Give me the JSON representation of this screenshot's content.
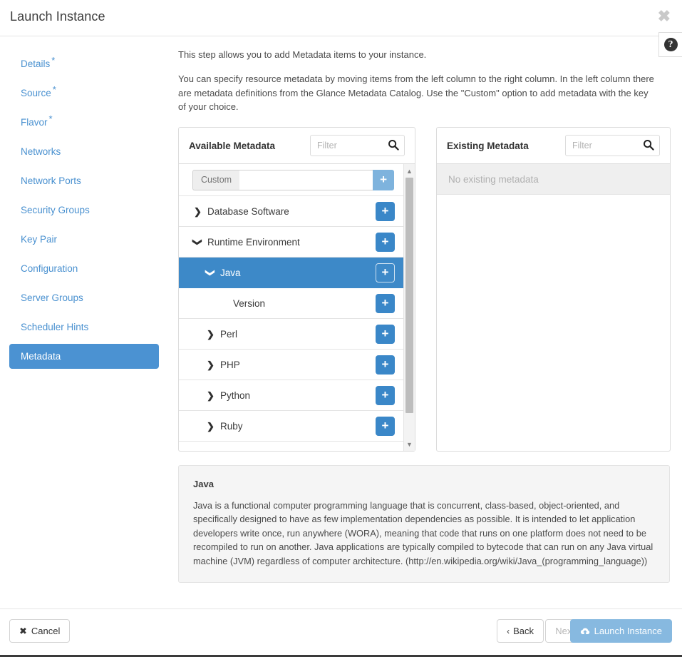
{
  "window": {
    "title": "Launch Instance",
    "close_label": "✖",
    "help_label": "?"
  },
  "sidebar": {
    "items": [
      {
        "label": "Details",
        "required": true,
        "active": false
      },
      {
        "label": "Source",
        "required": true,
        "active": false
      },
      {
        "label": "Flavor",
        "required": true,
        "active": false
      },
      {
        "label": "Networks",
        "required": false,
        "active": false
      },
      {
        "label": "Network Ports",
        "required": false,
        "active": false
      },
      {
        "label": "Security Groups",
        "required": false,
        "active": false
      },
      {
        "label": "Key Pair",
        "required": false,
        "active": false
      },
      {
        "label": "Configuration",
        "required": false,
        "active": false
      },
      {
        "label": "Server Groups",
        "required": false,
        "active": false
      },
      {
        "label": "Scheduler Hints",
        "required": false,
        "active": false
      },
      {
        "label": "Metadata",
        "required": false,
        "active": true
      }
    ],
    "required_marker": "*"
  },
  "main": {
    "intro_line_1": "This step allows you to add Metadata items to your instance.",
    "intro_line_2": "You can specify resource metadata by moving items from the left column to the right column. In the left column there are metadata definitions from the Glance Metadata Catalog. Use the \"Custom\" option to add metadata with the key of your choice."
  },
  "available_panel": {
    "title": "Available Metadata",
    "filter_placeholder": "Filter",
    "filter_value": "",
    "custom_row": {
      "tag_label": "Custom",
      "input_value": "",
      "input_placeholder": "",
      "add_label": "+"
    },
    "add_label": "+",
    "tree": [
      {
        "label": "Database Software",
        "level": 0,
        "chevron": "collapsed",
        "selected": false
      },
      {
        "label": "Runtime Environment",
        "level": 0,
        "chevron": "expanded",
        "selected": false
      },
      {
        "label": "Java",
        "level": 1,
        "chevron": "expanded",
        "selected": true
      },
      {
        "label": "Version",
        "level": 2,
        "chevron": "none",
        "selected": false
      },
      {
        "label": "Perl",
        "level": 1,
        "chevron": "collapsed",
        "selected": false
      },
      {
        "label": "PHP",
        "level": 1,
        "chevron": "collapsed",
        "selected": false
      },
      {
        "label": "Python",
        "level": 1,
        "chevron": "collapsed",
        "selected": false
      },
      {
        "label": "Ruby",
        "level": 1,
        "chevron": "collapsed",
        "selected": false
      }
    ]
  },
  "existing_panel": {
    "title": "Existing Metadata",
    "filter_placeholder": "Filter",
    "filter_value": "",
    "empty_message": "No existing metadata"
  },
  "description": {
    "title": "Java",
    "body": "Java is a functional computer programming language that is concurrent, class-based, object-oriented, and specifically designed to have as few implementation dependencies as possible. It is intended to let application developers write once, run anywhere (WORA), meaning that code that runs on one platform does not need to be recompiled to run on another. Java applications are typically compiled to bytecode that can run on any Java virtual machine (JVM) regardless of computer architecture. (http://en.wikipedia.org/wiki/Java_(programming_language))"
  },
  "footer": {
    "cancel_label": "Cancel",
    "back_label": "Back",
    "next_label": "Next",
    "launch_label": "Launch Instance",
    "next_disabled": true
  },
  "colors": {
    "accent": "#4b92d2",
    "tree_selected": "#3d89c8",
    "plus_button": "#3a87c8",
    "launch_button": "#87b9e0",
    "link": "#4a91d0"
  }
}
